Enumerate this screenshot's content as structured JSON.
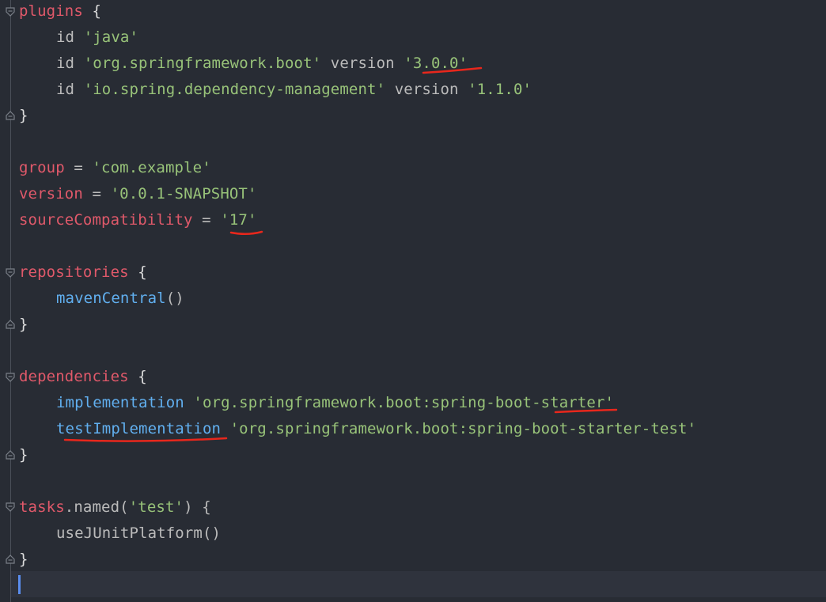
{
  "colors": {
    "background": "#282c34",
    "keyword": "#e0596a",
    "string": "#98c379",
    "function": "#61afef",
    "text": "#bbbbbb",
    "annotation": "#e8271c",
    "caret": "#5a8dee"
  },
  "code": {
    "plugins_kw": "plugins",
    "open_brace": " {",
    "close_brace": "}",
    "id_kw": "id ",
    "java_str": "'java'",
    "boot_str": "'org.springframework.boot'",
    "version_kw": " version ",
    "boot_version_str": "'3.0.0'",
    "depmgmt_str": "'io.spring.dependency-management'",
    "depmgmt_version_str": "'1.1.0'",
    "group_kw": "group",
    "equals": " = ",
    "group_str": "'com.example'",
    "version_var": "version",
    "version_str": "'0.0.1-SNAPSHOT'",
    "source_kw": "sourceCompatibility",
    "source_str": "'17'",
    "repositories_kw": "repositories",
    "maven_fn": "mavenCentral",
    "parens": "()",
    "dependencies_kw": "dependencies",
    "impl_fn": "implementation",
    "impl_str": " 'org.springframework.boot:spring-boot-starter'",
    "testimpl_fn": "testImplementation",
    "testimpl_str": " 'org.springframework.boot:spring-boot-starter-test'",
    "tasks_kw": "tasks",
    "named_call": ".named(",
    "test_str": "'test'",
    "named_close": ") {",
    "junit_call": "useJUnitPlatform()"
  }
}
